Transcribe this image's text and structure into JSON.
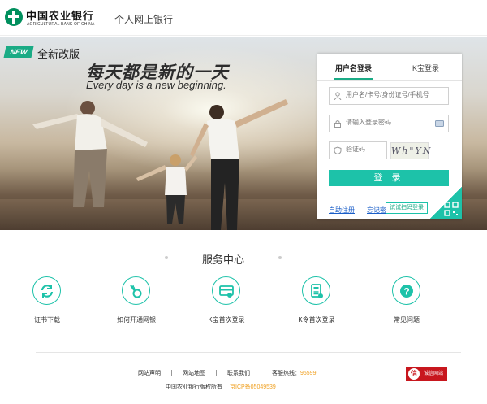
{
  "header": {
    "bank_name_cn": "中国农业银行",
    "bank_name_en": "AGRICULTURAL BANK OF CHINA",
    "subtitle": "个人网上银行"
  },
  "banner": {
    "new_badge": "NEW",
    "new_version": "全新改版",
    "slogan_cn": "每天都是新的一天",
    "slogan_en": "Every day is a new beginning."
  },
  "login": {
    "tab_user": "用户名登录",
    "tab_kbao": "K宝登录",
    "username_placeholder": "用户名/卡号/身份证号/手机号",
    "password_placeholder": "请输入登录密码",
    "captcha_placeholder": "验证码",
    "captcha_text": "Wh\"YN",
    "submit_label": "登 录",
    "register_link": "自助注册",
    "forgot_link": "忘记密",
    "scan_tip": "试试扫码登录"
  },
  "services": {
    "title": "服务中心",
    "items": [
      {
        "label": "证书下载",
        "icon": "refresh-icon"
      },
      {
        "label": "如何开通网银",
        "icon": "key-icon"
      },
      {
        "label": "K宝首次登录",
        "icon": "card-icon"
      },
      {
        "label": "K令首次登录",
        "icon": "token-icon"
      },
      {
        "label": "常见问题",
        "icon": "question-icon"
      }
    ]
  },
  "footer": {
    "links": [
      "网站声明",
      "网站地图",
      "联系我们"
    ],
    "hotline_label": "客服热线：",
    "hotline": "95599",
    "copyright": "中国农业银行版权所有",
    "icp": "京ICP备05049539",
    "trust_seal": "信",
    "trust_label": "诚信网站"
  },
  "colors": {
    "brand_green": "#008f5d",
    "accent_teal": "#1dc2a9",
    "link_blue": "#1a5ec8",
    "hotline_orange": "#f0a020"
  }
}
